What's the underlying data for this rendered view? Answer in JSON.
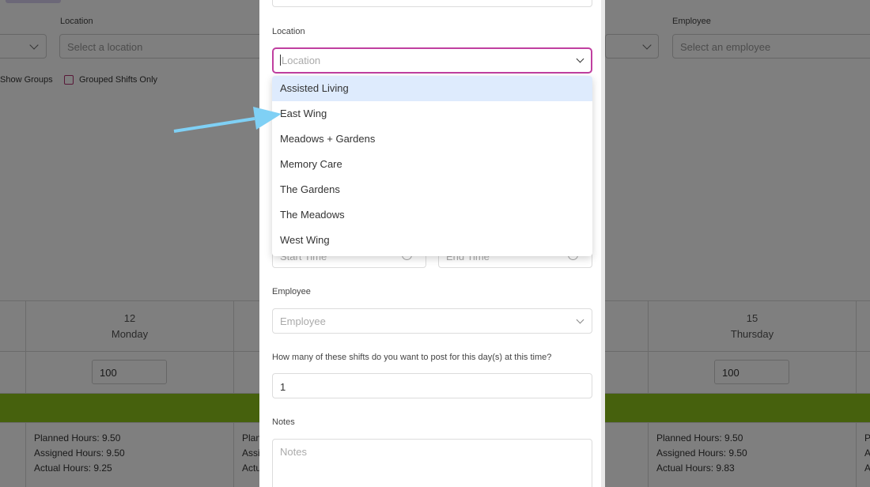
{
  "background": {
    "filters": {
      "location_label": "Location",
      "location_placeholder": "Select a location",
      "employee_label": "Employee",
      "employee_placeholder": "Select an employee",
      "show_groups_label": "Show Groups",
      "grouped_shifts_label": "Grouped Shifts Only"
    },
    "calendar": {
      "days": [
        {
          "num": "12",
          "name": "Monday",
          "capacity": "100",
          "planned": "Planned Hours: 9.50",
          "assigned": "Assigned Hours: 9.50",
          "actual": "Actual Hours: 9.25"
        },
        {
          "num": "15",
          "name": "Thursday",
          "capacity": "100",
          "planned": "Planned Hours: 9.50",
          "assigned": "Assigned Hours: 9.50",
          "actual": "Actual Hours: 9.83"
        }
      ],
      "partial": {
        "planned": "Plan",
        "assigned": "Assi",
        "actual": "Actu",
        "edge": "P",
        "edge2": "A",
        "edge3": "A"
      }
    }
  },
  "modal": {
    "location": {
      "label": "Location",
      "placeholder": "Location",
      "options": [
        "Assisted Living",
        "East Wing",
        "Meadows + Gardens",
        "Memory Care",
        "The Gardens",
        "The Meadows",
        "West Wing"
      ]
    },
    "time": {
      "start_placeholder": "Start Time",
      "end_placeholder": "End Time"
    },
    "employee": {
      "label": "Employee",
      "placeholder": "Employee"
    },
    "shift_count": {
      "label": "How many of these shifts do you want to post for this day(s) at this time?",
      "value": "1"
    },
    "notes": {
      "label": "Notes",
      "placeholder": "Notes"
    }
  },
  "colors": {
    "focus_border": "#c03fa0",
    "highlight": "#deebfd",
    "green_band": "#8cc21b",
    "arrow": "#7fd0f5"
  }
}
